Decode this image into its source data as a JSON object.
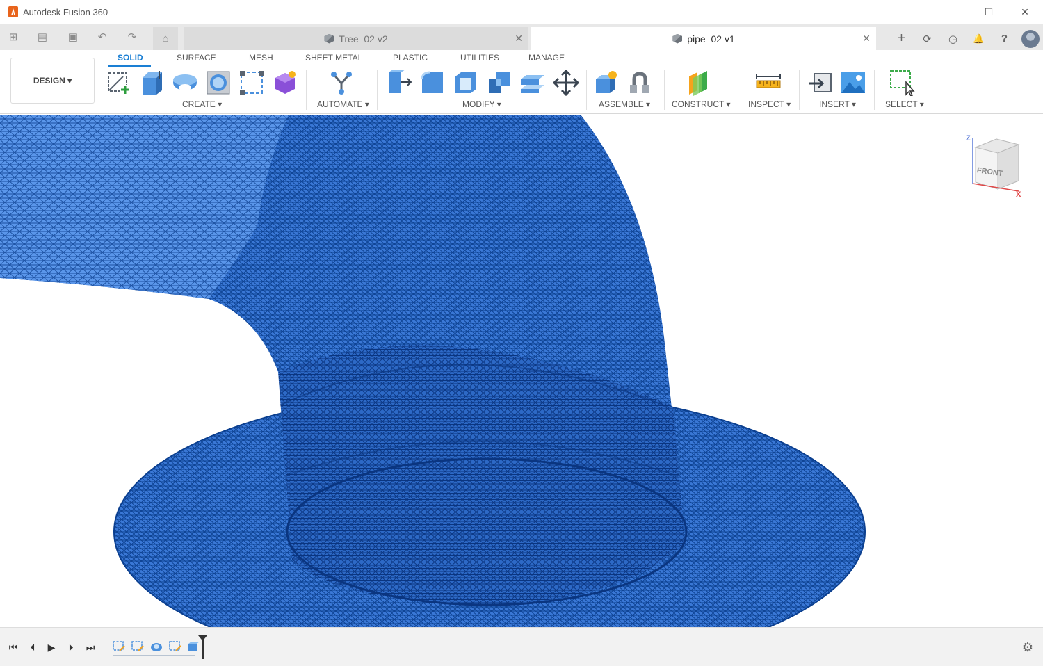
{
  "window": {
    "title": "Autodesk Fusion 360",
    "minimize": "—",
    "maximize": "☐",
    "close": "✕"
  },
  "tabs": [
    {
      "label": "Tree_02 v2",
      "close": "✕",
      "active": false
    },
    {
      "label": "pipe_02 v1",
      "close": "✕",
      "active": true
    }
  ],
  "toolbar": {
    "design_label": "DESIGN ▾",
    "workspace_tabs": [
      "SOLID",
      "SURFACE",
      "MESH",
      "SHEET METAL",
      "PLASTIC",
      "UTILITIES",
      "MANAGE"
    ],
    "groups": [
      "CREATE ▾",
      "AUTOMATE ▾",
      "MODIFY ▾",
      "ASSEMBLE ▾",
      "CONSTRUCT ▾",
      "INSPECT ▾",
      "INSERT ▾",
      "SELECT ▾"
    ]
  },
  "viewcube": {
    "face_label": "FRONT",
    "axis_z": "Z",
    "axis_x": "X"
  },
  "colors": {
    "accent": "#1a7fd4",
    "mesh_fill": "#3a78d6",
    "mesh_wire": "#0b3f8f"
  },
  "icons": {
    "grid": "⊞",
    "file": "▤",
    "save": "▣",
    "undo": "↶",
    "redo": "↷",
    "home": "⌂",
    "add": "+",
    "refresh": "⟳",
    "clock": "◷",
    "bell": "🔔",
    "help": "?",
    "gear": "⚙"
  }
}
